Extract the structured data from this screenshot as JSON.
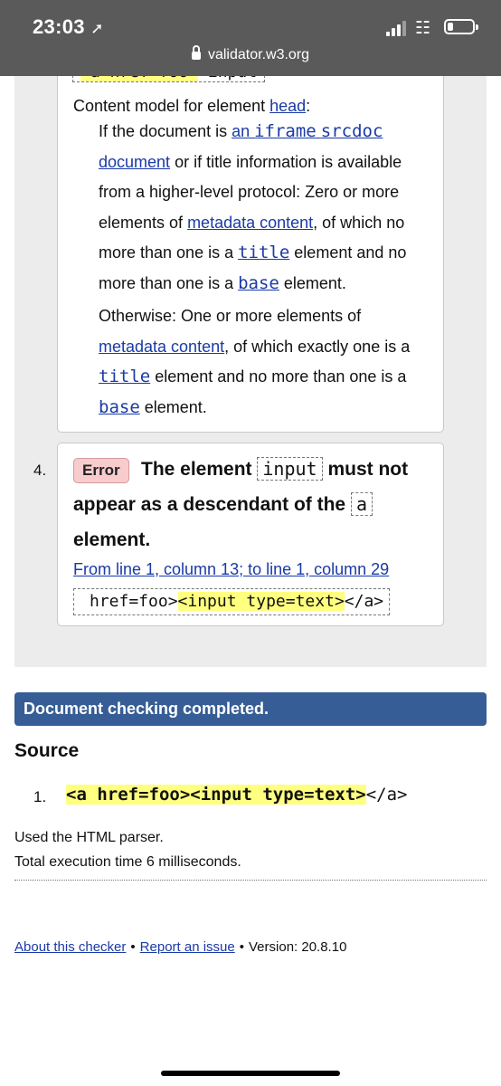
{
  "status_bar": {
    "time": "23:03",
    "location_icon": "location-arrow-icon",
    "url": "validator.w3.org"
  },
  "messages": [
    {
      "partial_extract_left": "<a href=foo>",
      "partial_extract_right": "<input",
      "content_model_label": "Content model for element ",
      "content_model_element": "head",
      "content_model_colon": ":",
      "para1": {
        "t1": "If the document is ",
        "l1a": "an ",
        "l1b": "iframe",
        "l1c": " ",
        "l1d": "srcdoc",
        "l1e": "document",
        "t2": " or if title information is available from a higher-level protocol: Zero or more elements of ",
        "l2": "metadata content",
        "t3": ", of which no more than one is a ",
        "l3": "title",
        "t4": " element and no more than one is a ",
        "l4": "base",
        "t5": " element."
      },
      "para2": {
        "t1": "Otherwise: One or more elements of ",
        "l1": "metadata content",
        "t2": ", of which exactly one is a ",
        "l2": "title",
        "t3": " element and no more than one is a ",
        "l3": "base",
        "t4": " element."
      }
    },
    {
      "number": "4.",
      "type": "Error",
      "text1": "The element",
      "code1": "input",
      "text2": "must not appear as a descendant of the",
      "code2": "a",
      "text3": "element.",
      "location": "From line 1, column 13; to line 1, column 29",
      "extract_before": "href=foo>",
      "extract_highlight": "<input type=text>",
      "extract_after": "</a>"
    }
  ],
  "completed_banner": "Document checking completed.",
  "source": {
    "title": "Source",
    "line_number": "1.",
    "highlight": "<a href=foo><input type=text>",
    "rest": "</a>"
  },
  "parser_info": "Used the HTML parser.",
  "execution_time": "Total execution time 6 milliseconds.",
  "footer": {
    "about": "About this checker",
    "sep": "•",
    "report": "Report an issue",
    "version": "Version: 20.8.10"
  }
}
